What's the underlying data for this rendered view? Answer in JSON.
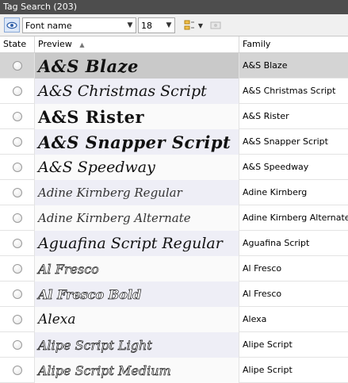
{
  "window": {
    "title": "Tag Search (203)"
  },
  "toolbar": {
    "search_field": "Font name",
    "size_value": "18",
    "icons": [
      "eye-icon",
      "tag-icon",
      "dropdown-arrow-icon",
      "tag-remove-icon"
    ]
  },
  "columns": {
    "state": "State",
    "preview": "Preview",
    "family": "Family",
    "sort_indicator": "▲"
  },
  "rows": [
    {
      "preview": "A&S Blaze",
      "family": "A&S Blaze",
      "selected": true,
      "style": "heavy"
    },
    {
      "preview": "A&S Christmas Script",
      "family": "A&S Christmas Script",
      "style": "script"
    },
    {
      "preview": "A&S Rister",
      "family": "A&S Rister",
      "style": "heavy"
    },
    {
      "preview": "A&S Snapper Script",
      "family": "A&S Snapper Script",
      "style": "heavy"
    },
    {
      "preview": "A&S Speedway",
      "family": "A&S Speedway",
      "style": "script"
    },
    {
      "preview": "Adine Kirnberg Regular",
      "family": "Adine Kirnberg",
      "style": "thin"
    },
    {
      "preview": "Adine Kirnberg Alternate",
      "family": "Adine Kirnberg Alternate",
      "style": "thin"
    },
    {
      "preview": "Aguafina Script Regular",
      "family": "Aguafina Script",
      "style": "script"
    },
    {
      "preview": "Al Fresco",
      "family": "Al Fresco",
      "style": "outline"
    },
    {
      "preview": "Al Fresco Bold",
      "family": "Al Fresco",
      "style": "outline"
    },
    {
      "preview": "Alexa",
      "family": "Alexa",
      "style": "script"
    },
    {
      "preview": "Alipe Script Light",
      "family": "Alipe Script",
      "style": "outline"
    },
    {
      "preview": "Alipe Script Medium",
      "family": "Alipe Script",
      "style": "outline"
    }
  ],
  "colors": {
    "title_bar": "#4d4d4d",
    "selected_row": "#d4d4d4",
    "toolbar": "#f0f0f0"
  }
}
